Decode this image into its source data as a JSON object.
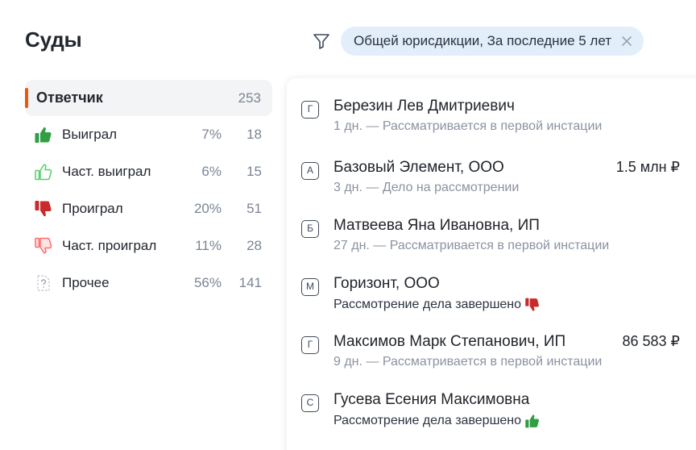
{
  "header": {
    "title": "Суды",
    "filter_chip": "Общей юрисдикции, За последние 5 лет"
  },
  "sidebar": {
    "head": {
      "label": "Ответчик",
      "count": "253"
    },
    "rows": [
      {
        "label": "Выиграл",
        "pct": "7%",
        "count": "18",
        "icon": "thumbs-up-filled-icon"
      },
      {
        "label": "Част. выиграл",
        "pct": "6%",
        "count": "15",
        "icon": "thumbs-up-outline-icon"
      },
      {
        "label": "Проиграл",
        "pct": "20%",
        "count": "51",
        "icon": "thumbs-down-filled-icon"
      },
      {
        "label": "Част. проиграл",
        "pct": "11%",
        "count": "28",
        "icon": "thumbs-down-outline-icon"
      },
      {
        "label": "Прочее",
        "pct": "56%",
        "count": "141",
        "icon": "document-question-icon"
      }
    ]
  },
  "cases": [
    {
      "badge": "Г",
      "name": "Березин Лев Дмитриевич",
      "amount": "",
      "status": "1 дн. — Рассматривается в первой инстации"
    },
    {
      "badge": "А",
      "name": "Базовый Элемент, ООО",
      "amount": "1.5 млн ₽",
      "status": "3 дн. — Дело на рассмотрении"
    },
    {
      "badge": "Б",
      "name": "Матвеева Яна Ивановна, ИП",
      "amount": "",
      "status": "27 дн. — Рассматривается в первой инстации"
    },
    {
      "badge": "М",
      "name": "Горизонт, ООО",
      "amount": "",
      "status": "Рассмотрение дела завершено",
      "result_icon": "thumbs-down-filled-icon"
    },
    {
      "badge": "Г",
      "name": "Максимов Марк Степанович, ИП",
      "amount": "86 583 ₽",
      "status": "9 дн. — Рассматривается в первой инстации"
    },
    {
      "badge": "С",
      "name": "Гусева Есения Максимовна",
      "amount": "",
      "status": "Рассмотрение дела завершено",
      "result_icon": "thumbs-up-filled-icon"
    }
  ],
  "colors": {
    "accent": "#e8590c",
    "win": "#2f9e44",
    "win_light": "#51cf66",
    "lose": "#c92a2a",
    "lose_light": "#ff6b6b",
    "chip_bg": "#e3eefb"
  }
}
